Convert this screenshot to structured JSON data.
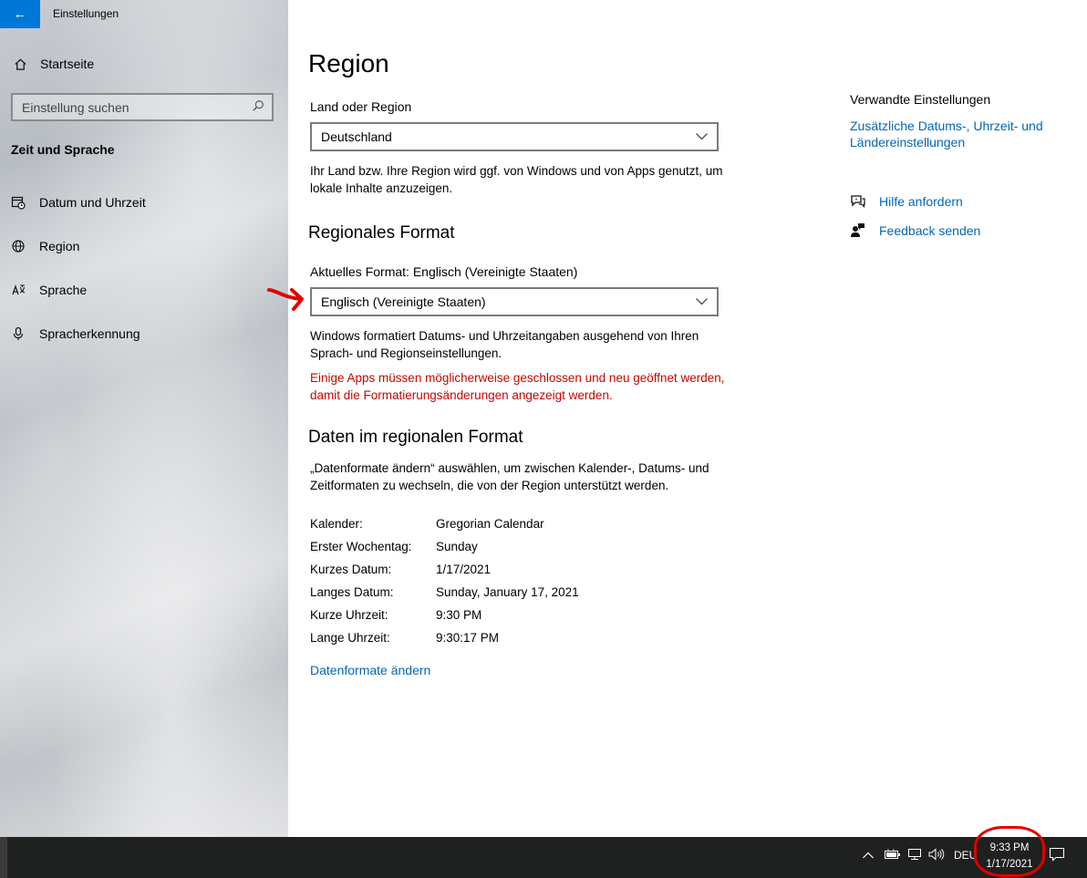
{
  "window": {
    "title": "Einstellungen",
    "back_icon": "←",
    "minimize_icon": "—",
    "maximize_icon": "☐",
    "close_icon": "✕"
  },
  "sidebar": {
    "home_label": "Startseite",
    "search_placeholder": "Einstellung suchen",
    "section_title": "Zeit und Sprache",
    "items": [
      {
        "label": "Datum und Uhrzeit",
        "icon": "calendar-clock-icon"
      },
      {
        "label": "Region",
        "icon": "globe-icon"
      },
      {
        "label": "Sprache",
        "icon": "language-icon"
      },
      {
        "label": "Spracherkennung",
        "icon": "microphone-icon"
      }
    ]
  },
  "main": {
    "title": "Region",
    "country_label": "Land oder Region",
    "country_value": "Deutschland",
    "country_note": "Ihr Land bzw. Ihre Region wird ggf. von Windows und von Apps genutzt, um lokale Inhalte anzuzeigen.",
    "format_heading": "Regionales Format",
    "current_format_label": "Aktuelles Format: Englisch (Vereinigte Staaten)",
    "format_value": "Englisch (Vereinigte Staaten)",
    "format_note": "Windows formatiert Datums- und Uhrzeitangaben ausgehend von Ihren Sprach- und Regionseinstellungen.",
    "format_warning": "Einige Apps müssen möglicherweise geschlossen und neu geöffnet werden, damit die Formatierungsänderungen angezeigt werden.",
    "data_heading": "Daten im regionalen Format",
    "data_note": "„Datenformate ändern“ auswählen, um zwischen Kalender-, Datums- und Zeitformaten zu wechseln, die von der Region unterstützt werden.",
    "rows": [
      {
        "key": "Kalender:",
        "value": "Gregorian Calendar"
      },
      {
        "key": "Erster Wochentag:",
        "value": "Sunday"
      },
      {
        "key": "Kurzes Datum:",
        "value": "1/17/2021"
      },
      {
        "key": "Langes Datum:",
        "value": "Sunday, January 17, 2021"
      },
      {
        "key": "Kurze Uhrzeit:",
        "value": "9:30 PM"
      },
      {
        "key": "Lange Uhrzeit:",
        "value": "9:30:17 PM"
      }
    ],
    "change_formats_link": "Datenformate ändern"
  },
  "related": {
    "title": "Verwandte Einstellungen",
    "link": "Zusätzliche Datums-, Uhrzeit- und Ländereinstellungen",
    "help_label": "Hilfe anfordern",
    "feedback_label": "Feedback senden"
  },
  "taskbar": {
    "language": "DEU",
    "time": "9:33 PM",
    "date": "1/17/2021"
  },
  "colors": {
    "accent": "#0078d7",
    "link": "#0067b8",
    "warning": "#c50500",
    "annotation": "#e00000"
  }
}
